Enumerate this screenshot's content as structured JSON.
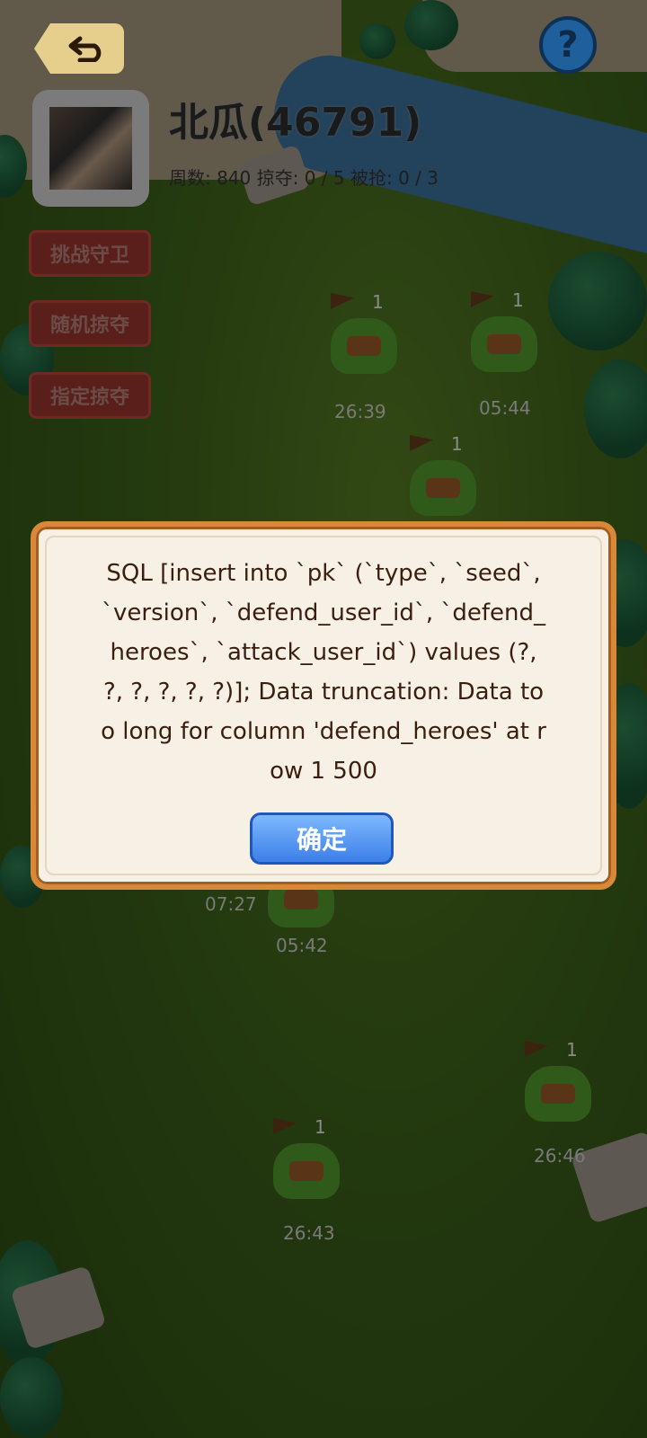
{
  "header": {
    "player_name": "北瓜(46791)",
    "stats": "周数: 840  掠夺: 0 / 5  被抢: 0 / 3",
    "help_symbol": "?"
  },
  "side_buttons": [
    {
      "label": "挑战守卫"
    },
    {
      "label": "随机掠夺"
    },
    {
      "label": "指定掠夺"
    }
  ],
  "monsters": [
    {
      "count": "1",
      "timer": "26:39"
    },
    {
      "count": "1",
      "timer": "05:44"
    },
    {
      "count": "1",
      "timer": ""
    },
    {
      "count": "",
      "timer": "07:27"
    },
    {
      "count": "",
      "timer": "05:42"
    },
    {
      "count": "1",
      "timer": "26:46"
    },
    {
      "count": "1",
      "timer": "26:43"
    }
  ],
  "dialog": {
    "message": "SQL [insert into `pk` (`type`, `seed`, `version`, `defend_user_id`, `defend_heroes`, `attack_user_id`) values (?, ?, ?, ?, ?, ?)]; Data truncation: Data too long for column 'defend_heroes' at row 1 500",
    "confirm_label": "确定"
  },
  "colors": {
    "dialog_border": "#d9883a",
    "confirm_button": "#3b7fe8",
    "side_button": "#5a1f1a"
  }
}
